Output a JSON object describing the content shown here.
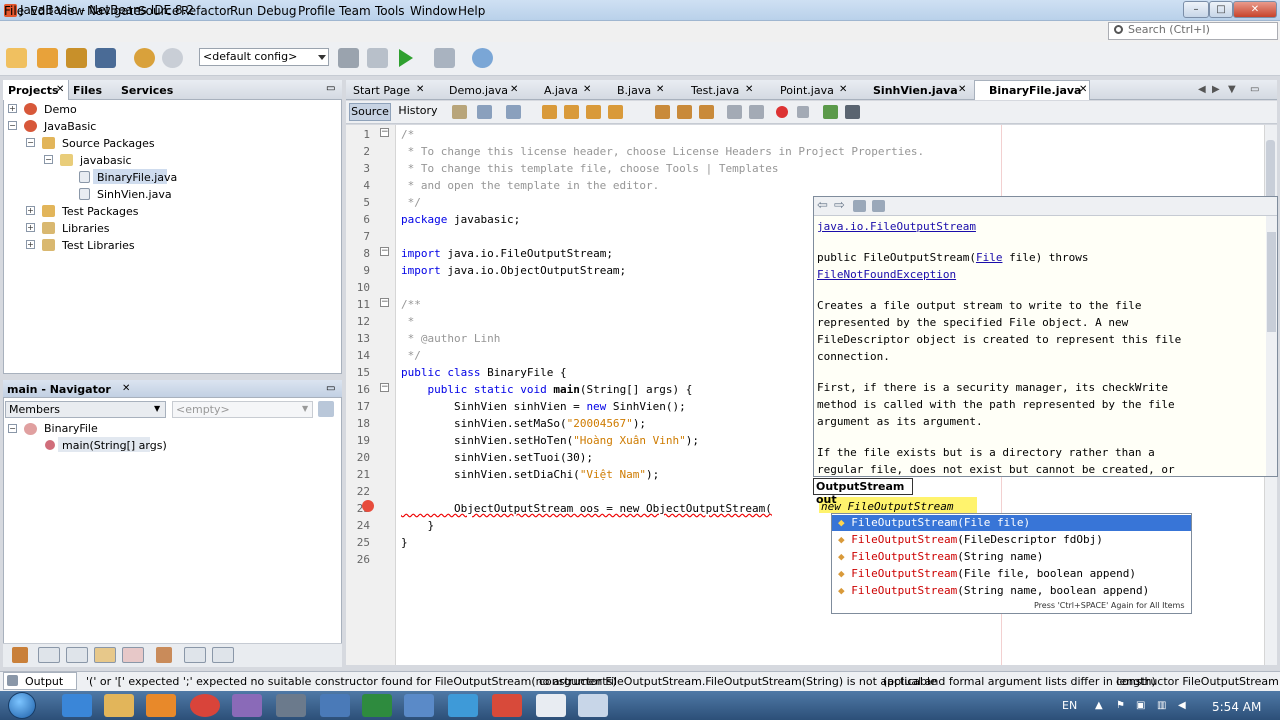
{
  "window": {
    "title": "JavaBasic - NetBeans IDE 8.2",
    "min": "–",
    "max": "□",
    "close": "✕"
  },
  "menu": [
    "File",
    "Edit",
    "View",
    "Navigate",
    "Source",
    "Refactor",
    "Run",
    "Debug",
    "Profile",
    "Team",
    "Tools",
    "Window",
    "Help"
  ],
  "search": {
    "placeholder": "Search (Ctrl+I)"
  },
  "toolbar": {
    "config": "<default config>"
  },
  "projects": {
    "tabs": [
      "Projects",
      "Files",
      "Services"
    ],
    "tree": [
      "Demo",
      "JavaBasic",
      "Source Packages",
      "javabasic",
      "BinaryFile.java",
      "SinhVien.java",
      "Test Packages",
      "Libraries",
      "Test Libraries"
    ]
  },
  "navigator": {
    "title": "main - Navigator",
    "members": "Members",
    "empty": "<empty>",
    "tree": [
      "BinaryFile",
      "main(String[] args)"
    ]
  },
  "editor": {
    "tabs": [
      "Start Page",
      "Demo.java",
      "A.java",
      "B.java",
      "Test.java",
      "Point.java",
      "SinhVien.java",
      "BinaryFile.java"
    ],
    "source": "Source",
    "history": "History",
    "line_numbers": [
      "1",
      "2",
      "3",
      "4",
      "5",
      "6",
      "7",
      "8",
      "9",
      "10",
      "11",
      "12",
      "13",
      "14",
      "15",
      "16",
      "17",
      "18",
      "19",
      "20",
      "21",
      "22",
      "23",
      "24",
      "25",
      "26"
    ],
    "code": {
      "l1": "/*",
      "l2": " * To change this license header, choose License Headers in Project Properties.",
      "l3": " * To change this template file, choose Tools | Templates",
      "l4": " * and open the template in the editor.",
      "l5": " */",
      "l6a": "package",
      "l6b": " javabasic;",
      "l8a": "import",
      "l8b": " java.io.FileOutputStream;",
      "l9a": "import",
      "l9b": " java.io.ObjectOutputStream;",
      "l11": "/**",
      "l12": " *",
      "l13": " * @author Linh",
      "l14": " */",
      "l15a": "public class",
      "l15b": " BinaryFile {",
      "l16a": "    public static void",
      "l16b": " main",
      "l16c": "(String[] args) {",
      "l17a": "        SinhVien sinhVien = ",
      "l17b": "new",
      "l17c": " SinhVien();",
      "l18a": "        sinhVien.setMaSo(",
      "l18b": "\"20004567\"",
      "l18c": ");",
      "l19a": "        sinhVien.setHoTen(",
      "l19b": "\"Hoàng Xuân Vinh\"",
      "l19c": ");",
      "l20": "        sinhVien.setTuoi(30);",
      "l21a": "        sinhVien.setDiaChi(",
      "l21b": "\"Việt Nam\"",
      "l21c": ");",
      "l23": "        ObjectOutputStream oos = new ObjectOutputStream(",
      "l23typed": "new FileOutputStream",
      "l24": "    }",
      "l25": "}"
    }
  },
  "javadoc": {
    "class_link": "java.io.FileOutputStream",
    "sig_a": "public FileOutputStream(",
    "sig_file": "File",
    "sig_b": " file) throws",
    "exception": "FileNotFoundException",
    "p1": [
      "Creates a file output stream to write to the file",
      "represented by the specified File object. A new",
      "FileDescriptor object is created to represent this file",
      "connection."
    ],
    "p2": [
      "First, if there is a security manager, its checkWrite",
      "method is called with the path represented by the file",
      "argument as its argument."
    ],
    "p3": [
      "If the file exists but is a directory rather than a",
      "regular file, does not exist but cannot be created, or"
    ]
  },
  "completion": {
    "tooltip": "OutputStream out",
    "items": [
      {
        "name": "FileOutputStream",
        "params": "(File file)"
      },
      {
        "name": "FileOutputStream",
        "params": "(FileDescriptor fdObj)"
      },
      {
        "name": "FileOutputStream",
        "params": "(String name)"
      },
      {
        "name": "FileOutputStream",
        "params": "(File file, boolean append)"
      },
      {
        "name": "FileOutputStream",
        "params": "(String name, boolean append)"
      }
    ],
    "hint": "Press 'Ctrl+SPACE' Again for All Items"
  },
  "output": {
    "tab": "Output",
    "messages": [
      "'(' or '[' expected ';' expected  no suitable constructor found for FileOutputStream(no arguments)",
      "constructor FileOutputStream.FileOutputStream(String) is not applicable",
      "(actual and formal argument lists differ in length)",
      "constructor FileOutputStream.FileO"
    ]
  },
  "taskbar": {
    "lang": "EN",
    "time": "5:54 AM"
  }
}
